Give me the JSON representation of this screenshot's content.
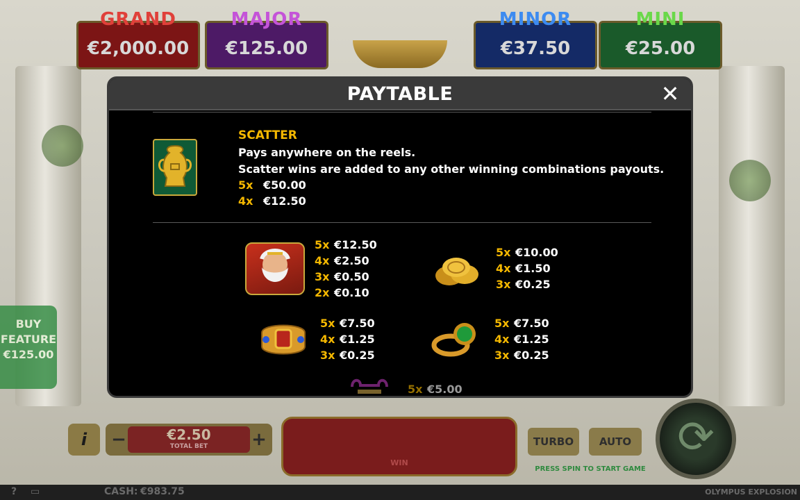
{
  "jackpots": [
    {
      "title": "GRAND",
      "value": "€2,000.00"
    },
    {
      "title": "MAJOR",
      "value": "€125.00"
    },
    {
      "title": "MINOR",
      "value": "€37.50"
    },
    {
      "title": "MINI",
      "value": "€25.00"
    }
  ],
  "buy_feature": {
    "line1": "BUY",
    "line2": "FEATURE",
    "price": "€125.00"
  },
  "controls": {
    "info": "i",
    "minus": "−",
    "plus": "+",
    "bet_value": "€2.50",
    "bet_label": "TOTAL BET",
    "win_label": "WIN",
    "turbo": "TURBO",
    "auto": "AUTO",
    "press_spin": "PRESS SPIN TO START GAME"
  },
  "status": {
    "help": "?",
    "cash_label": "CASH:",
    "cash_value": "€983.75",
    "game_title": "OLYMPUS EXPLOSION"
  },
  "paytable": {
    "title": "PAYTABLE",
    "close": "✕",
    "scatter": {
      "title": "SCATTER",
      "line1": "Pays anywhere on the reels.",
      "line2": "Scatter wins are added to any other winning combinations payouts.",
      "pays": [
        {
          "mult": "5x",
          "amount": "€50.00"
        },
        {
          "mult": "4x",
          "amount": "€12.50"
        }
      ]
    },
    "symbols": [
      {
        "name": "zeus",
        "pays": [
          {
            "mult": "5x",
            "amount": "€12.50"
          },
          {
            "mult": "4x",
            "amount": "€2.50"
          },
          {
            "mult": "3x",
            "amount": "€0.50"
          },
          {
            "mult": "2x",
            "amount": "€0.10"
          }
        ]
      },
      {
        "name": "coins",
        "pays": [
          {
            "mult": "5x",
            "amount": "€10.00"
          },
          {
            "mult": "4x",
            "amount": "€1.50"
          },
          {
            "mult": "3x",
            "amount": "€0.25"
          }
        ]
      },
      {
        "name": "bracelet",
        "pays": [
          {
            "mult": "5x",
            "amount": "€7.50"
          },
          {
            "mult": "4x",
            "amount": "€1.25"
          },
          {
            "mult": "3x",
            "amount": "€0.25"
          }
        ]
      },
      {
        "name": "ring",
        "pays": [
          {
            "mult": "5x",
            "amount": "€7.50"
          },
          {
            "mult": "4x",
            "amount": "€1.25"
          },
          {
            "mult": "3x",
            "amount": "€0.25"
          }
        ]
      },
      {
        "name": "lyre",
        "pays": [
          {
            "mult": "5x",
            "amount": "€5.00"
          }
        ]
      }
    ]
  },
  "colors": {
    "gold": "#f5b800",
    "modal_bg": "#000000",
    "header_bg": "#3a3a3a"
  }
}
